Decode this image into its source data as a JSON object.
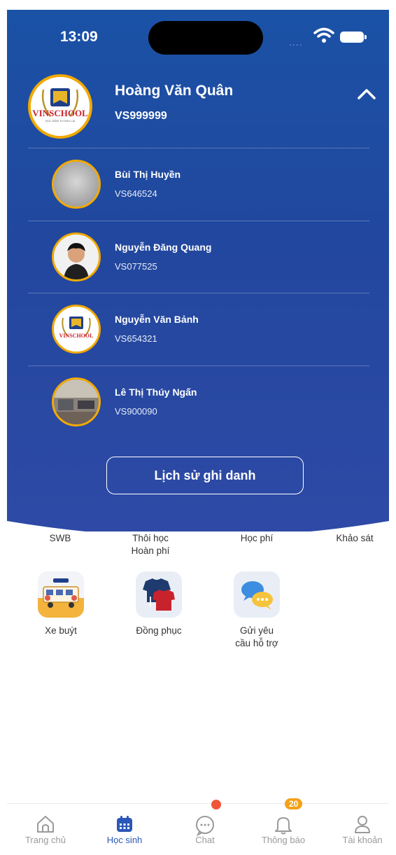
{
  "status_bar": {
    "time": "13:09",
    "signal": "...."
  },
  "profile": {
    "name": "Hoàng Văn Quân",
    "student_id": "VS999999",
    "logo_text": "VINSCHOOL",
    "logo_tagline": "HỌC MẦM TƯƠNG LAI"
  },
  "accounts": [
    {
      "name": "Bùi Thị Huyền",
      "student_id": "VS646524"
    },
    {
      "name": "Nguyễn Đăng Quang",
      "student_id": "VS077525"
    },
    {
      "name": "Nguyễn Văn Bảnh",
      "student_id": "VS654321"
    },
    {
      "name": "Lê Thị Thúy Ngấn",
      "student_id": "VS900090"
    }
  ],
  "history_button": "Lịch sử ghi danh",
  "menu_top": {
    "swb": "SWB",
    "withdraw_line1": "Thôi học",
    "withdraw_line2": "Hoàn phí",
    "tuition": "Học phí",
    "survey": "Khảo sát"
  },
  "menu_tiles": {
    "bus": "Xe buýt",
    "uniform": "Đồng phục",
    "support_line1": "Gửi yêu",
    "support_line2": "cầu hỗ trợ"
  },
  "nav": {
    "home": "Trang chủ",
    "students": "Học sinh",
    "chat": "Chat",
    "notifications": "Thông báo",
    "notifications_badge": "20",
    "account": "Tài khoản"
  },
  "colors": {
    "primary": "#1f4ea3",
    "accent": "#f2a900",
    "badge": "#f3a11a",
    "dot": "#f0553a"
  }
}
